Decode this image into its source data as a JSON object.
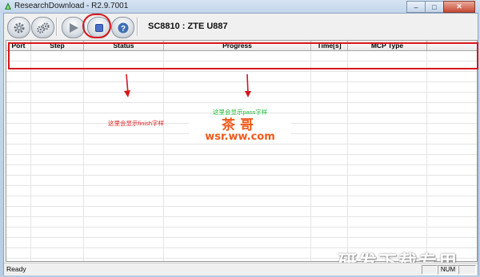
{
  "window": {
    "title": "ResearchDownload - R2.9.7001",
    "controls": [
      "–",
      "□",
      "✕"
    ]
  },
  "toolbar": {
    "buttons": [
      {
        "name": "settings",
        "icon": "gear-icon"
      },
      {
        "name": "load-packet",
        "icon": "gears-icon"
      },
      {
        "name": "start",
        "icon": "play-icon"
      },
      {
        "name": "stop",
        "icon": "stop-icon"
      },
      {
        "name": "help",
        "icon": "help-icon"
      }
    ],
    "device_label": "SC8810 : ZTE U887"
  },
  "grid": {
    "columns": [
      "Port",
      "Step",
      "Status",
      "Progress",
      "Time[s]",
      "MCP Type",
      ""
    ]
  },
  "annotations": {
    "finish_note": "这里会显示finish字样",
    "pass_note": "这里会显示pass字样"
  },
  "watermarks": {
    "logo_top": "茶哥",
    "logo_bottom": "wsr.ww.com",
    "corner": "研发下载专用"
  },
  "statusbar": {
    "text": "Ready",
    "panels": [
      "",
      "NUM",
      ""
    ]
  },
  "colors": {
    "highlight": "#d6171b",
    "finish_note": "#e02020",
    "pass_note": "#1fba3a",
    "watermark": "#f05a1a"
  }
}
